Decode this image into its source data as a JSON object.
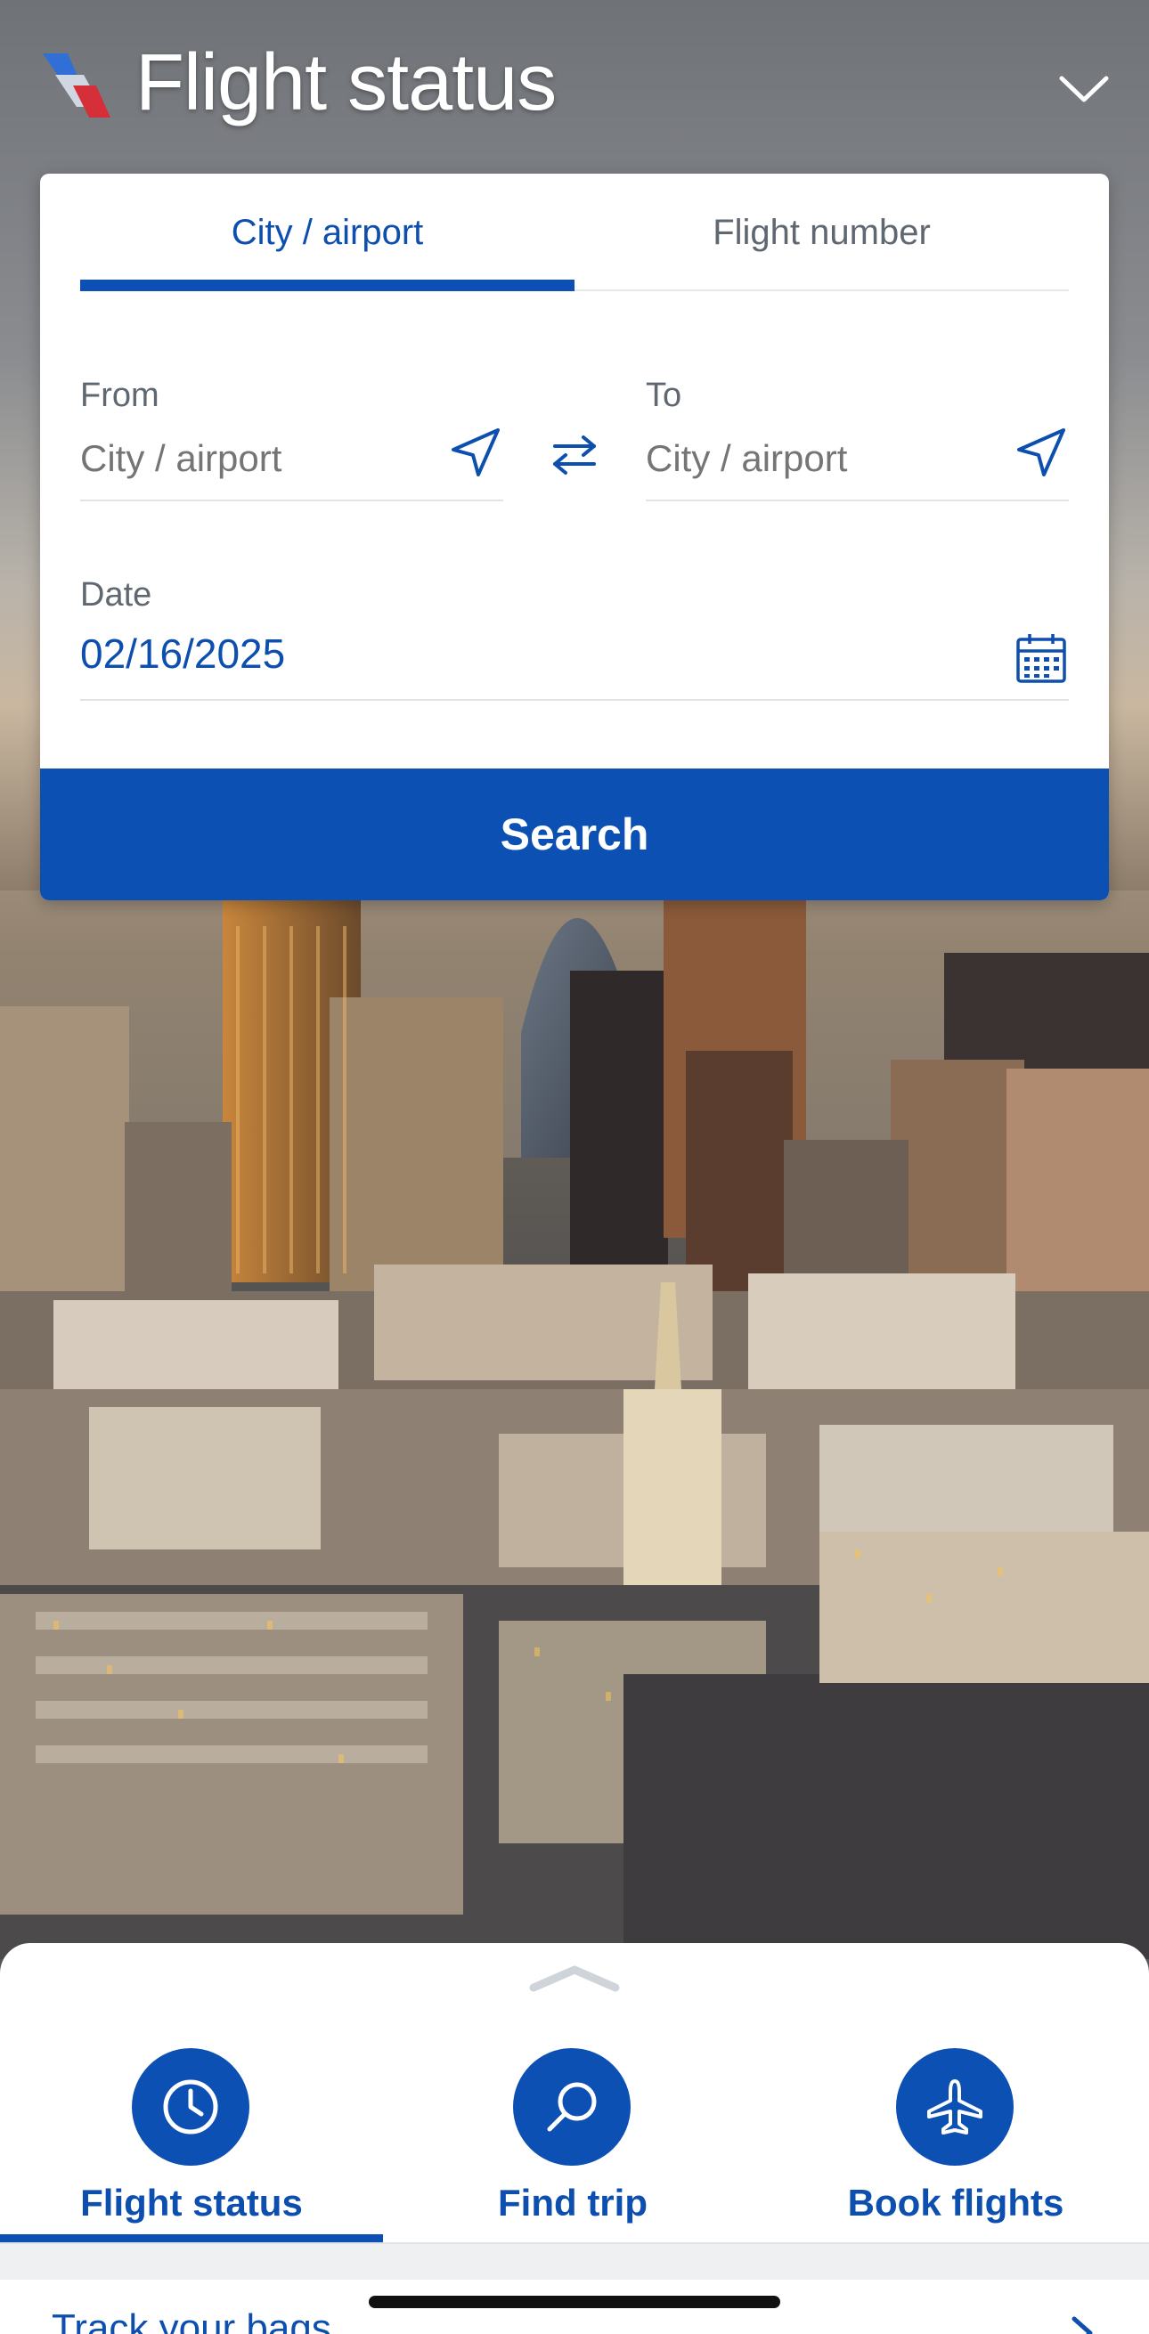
{
  "header": {
    "title": "Flight status"
  },
  "search_card": {
    "tabs": [
      {
        "label": "City / airport",
        "active": true
      },
      {
        "label": "Flight number",
        "active": false
      }
    ],
    "from": {
      "label": "From",
      "placeholder": "City / airport"
    },
    "to": {
      "label": "To",
      "placeholder": "City / airport"
    },
    "date": {
      "label": "Date",
      "value": "02/16/2025"
    },
    "search_label": "Search"
  },
  "bottom_nav": {
    "items": [
      {
        "label": "Flight status",
        "icon": "clock-icon",
        "active": true
      },
      {
        "label": "Find trip",
        "icon": "search-icon",
        "active": false
      },
      {
        "label": "Book flights",
        "icon": "plane-icon",
        "active": false
      }
    ],
    "track_label": "Track your bags"
  },
  "colors": {
    "brand_blue": "#0d50b4",
    "text_gray": "#5f6770",
    "placeholder_gray": "#a9aeb4"
  }
}
